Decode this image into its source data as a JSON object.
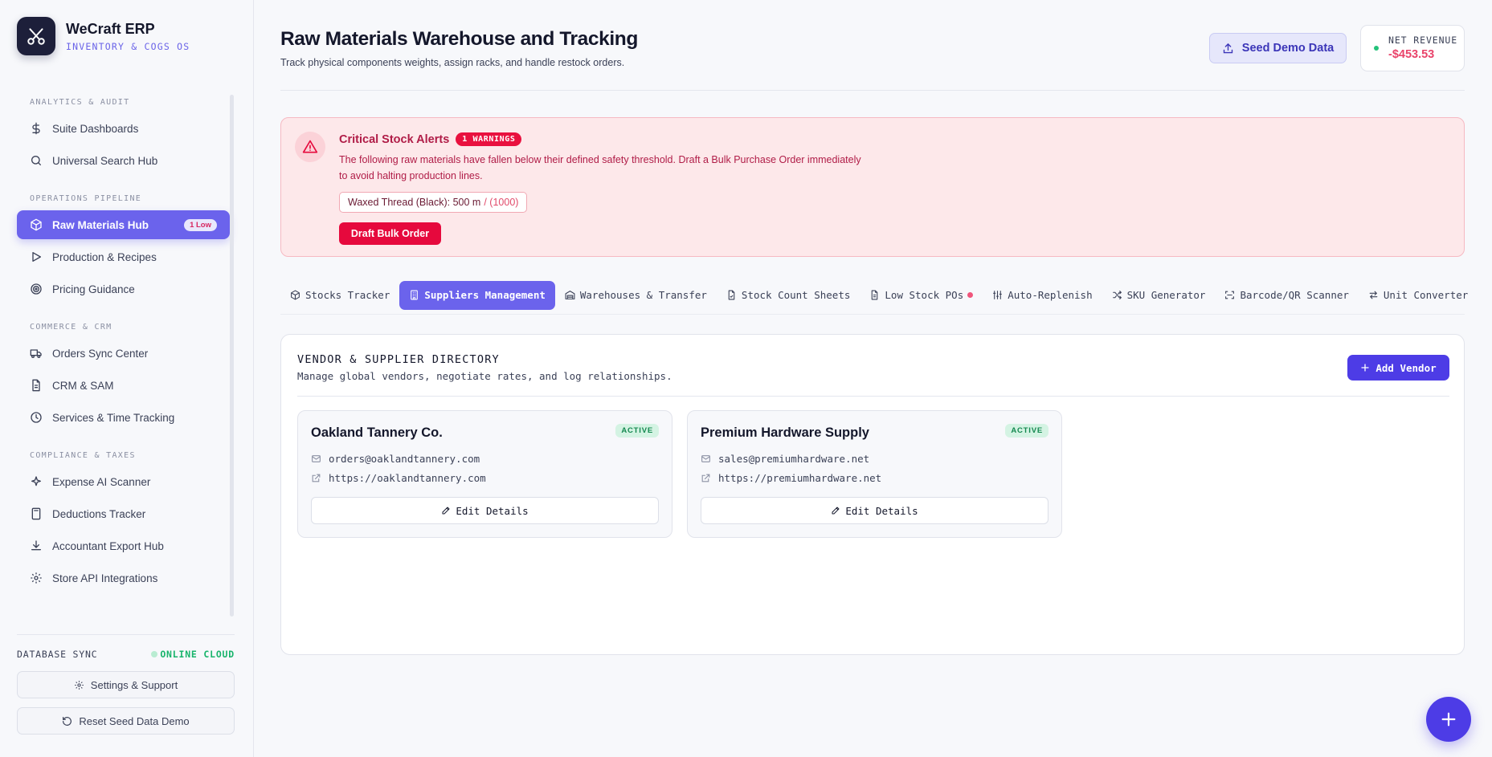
{
  "brand": {
    "title": "WeCraft ERP",
    "subtitle": "INVENTORY & COGS OS"
  },
  "sidebar": {
    "sections": [
      {
        "label": "ANALYTICS & AUDIT",
        "items": [
          {
            "label": "Suite Dashboards",
            "icon": "dollar-icon"
          },
          {
            "label": "Universal Search Hub",
            "icon": "search-icon"
          }
        ]
      },
      {
        "label": "OPERATIONS PIPELINE",
        "items": [
          {
            "label": "Raw Materials Hub",
            "icon": "box-icon",
            "active": true,
            "badge": "1 Low"
          },
          {
            "label": "Production & Recipes",
            "icon": "play-icon"
          },
          {
            "label": "Pricing Guidance",
            "icon": "target-icon"
          }
        ]
      },
      {
        "label": "COMMERCE & CRM",
        "items": [
          {
            "label": "Orders Sync Center",
            "icon": "truck-icon"
          },
          {
            "label": "CRM & SAM",
            "icon": "document-icon"
          },
          {
            "label": "Services & Time Tracking",
            "icon": "clock-icon"
          }
        ]
      },
      {
        "label": "COMPLIANCE & TAXES",
        "items": [
          {
            "label": "Expense AI Scanner",
            "icon": "sparkle-icon"
          },
          {
            "label": "Deductions Tracker",
            "icon": "calculator-icon"
          },
          {
            "label": "Accountant Export Hub",
            "icon": "download-icon"
          },
          {
            "label": "Store API Integrations",
            "icon": "gear-icon"
          }
        ]
      }
    ],
    "footer": {
      "db_label": "DATABASE SYNC",
      "db_status": "ONLINE CLOUD",
      "settings_label": "Settings & Support",
      "reset_label": "Reset Seed Data Demo"
    }
  },
  "header": {
    "title": "Raw Materials Warehouse and Tracking",
    "subtitle": "Track physical components weights, assign racks, and handle restock orders.",
    "seed_button": "Seed Demo Data",
    "revenue_label": "NET REVENUE",
    "revenue_value": "-$453.53"
  },
  "alert": {
    "title": "Critical Stock Alerts",
    "badge": "1 WARNINGS",
    "line1": "The following raw materials have fallen below their defined safety threshold. Draft a Bulk Purchase Order immediately",
    "line2": "to avoid halting production lines.",
    "item_name": "Waxed Thread (Black): 500 m",
    "item_threshold": "/ (1000)",
    "button": "Draft Bulk Order"
  },
  "tabs": [
    {
      "label": "Stocks Tracker",
      "icon": "box-icon"
    },
    {
      "label": "Suppliers Management",
      "icon": "building-icon",
      "active": true
    },
    {
      "label": "Warehouses & Transfer",
      "icon": "warehouse-icon"
    },
    {
      "label": "Stock Count Sheets",
      "icon": "file-icon"
    },
    {
      "label": "Low Stock POs",
      "icon": "document-icon",
      "dot": true
    },
    {
      "label": "Auto-Replenish",
      "icon": "sliders-icon"
    },
    {
      "label": "SKU Generator",
      "icon": "shuffle-icon"
    },
    {
      "label": "Barcode/QR Scanner",
      "icon": "scan-icon"
    },
    {
      "label": "Unit Converter",
      "icon": "swap-icon"
    }
  ],
  "directory": {
    "title": "VENDOR & SUPPLIER DIRECTORY",
    "subtitle": "Manage global vendors, negotiate rates, and log relationships.",
    "add_button": "Add Vendor",
    "vendors": [
      {
        "name": "Oakland Tannery Co.",
        "status": "ACTIVE",
        "email": "orders@oaklandtannery.com",
        "website": "https://oaklandtannery.com",
        "edit": "Edit Details"
      },
      {
        "name": "Premium Hardware Supply",
        "status": "ACTIVE",
        "email": "sales@premiumhardware.net",
        "website": "https://premiumhardware.net",
        "edit": "Edit Details"
      }
    ]
  },
  "colors": {
    "accent": "#6b63ec",
    "primary": "#4d3ce6",
    "danger": "#e6093d",
    "success": "#18b46b"
  }
}
